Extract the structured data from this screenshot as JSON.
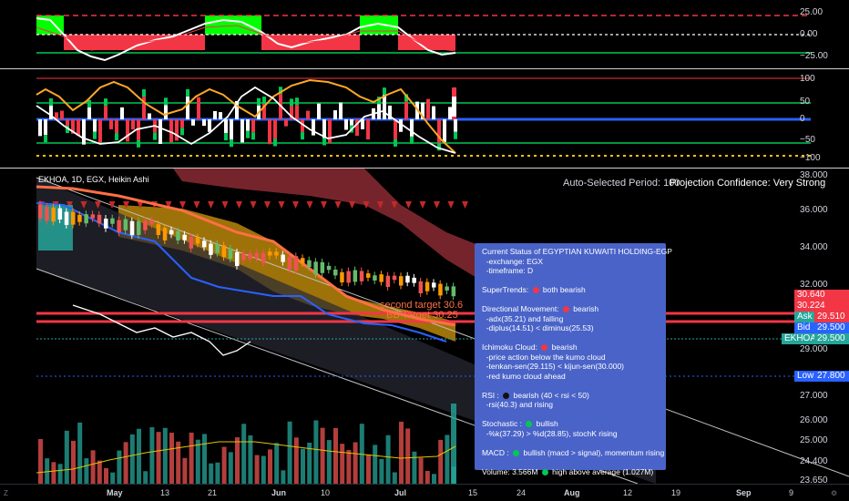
{
  "colors": {
    "bull": "#26a69a",
    "bear": "#ef5350",
    "green_block": "#00ff00",
    "red_block": "#f23645",
    "orange": "#ff9800",
    "blue_line": "#2962ff",
    "panel_bg": "#4a63c8"
  },
  "top_pane": {
    "scale": [
      "25.00",
      "0.00",
      "−25.00"
    ]
  },
  "mid_pane": {
    "scale": [
      "100",
      "50",
      "0",
      "−50",
      "−100"
    ]
  },
  "main_pane": {
    "symbol": "EKHOA, 1D, EGX, Heikin Ashi",
    "auto_period": "Auto-Selected Period: 100",
    "projection_confidence": "Projection Confidence: Very Strong",
    "scale": [
      "38.000",
      "36.000",
      "34.000",
      "32.000",
      "29.000",
      "28.000",
      "27.000",
      "26.000",
      "25.000",
      "24.400",
      "23.650"
    ],
    "second_target": "second target 30.6",
    "bb_target": "BB Target 30.25",
    "tags": {
      "red1": "30.640",
      "red2": "30.224",
      "ask_label": "Ask",
      "ask_value": "29.510",
      "bid_label": "Bid",
      "bid_value": "29.500",
      "symbol_label": "EKHOA",
      "symbol_value": "29.500",
      "low_label": "Low",
      "low_value": "27.800"
    }
  },
  "status_panel": {
    "title": "Current Status of EGYPTIAN KUWAITI HOLDING-EGP",
    "exchange": "  -exchange: EGX",
    "timeframe": "  -timeframe: D",
    "supertrends": "SuperTrends: ",
    "supertrends_val": " both bearish",
    "dm": "Directional Movement: ",
    "dm_val": " bearish",
    "adx": "  -adx(35.21) and falling",
    "diplus": "  -diplus(14.51) < diminus(25.53)",
    "ichimoku": "Ichimoku Cloud: ",
    "ichimoku_val": " bearish",
    "ich1": "  -price action below the kumo cloud",
    "ich2": "  -tenkan-sen(29.115) < kijun-sen(30.000)",
    "ich3": "  -red kumo cloud ahead",
    "rsi": "RSI : ",
    "rsi_val": " bearish (40 < rsi < 50)",
    "rsi2": "  -rsi(40.3) and rising",
    "stoch": "Stochastic : ",
    "stoch_val": " bullish",
    "stoch2": "  -%k(37.29) > %d(28.85), stochK rising",
    "macd": "MACD : ",
    "macd_val": " bullish (macd > signal), momentum rising",
    "volume": "Volume: 3.566M ",
    "volume_val": " high above average (1.027M)"
  },
  "xaxis": {
    "labels": [
      "May",
      "13",
      "21",
      "Jun",
      "10",
      "Jul",
      "15",
      "24",
      "Aug",
      "12",
      "19",
      "Sep",
      "9"
    ],
    "nav_left": "Z",
    "nav_right": "⚙"
  }
}
